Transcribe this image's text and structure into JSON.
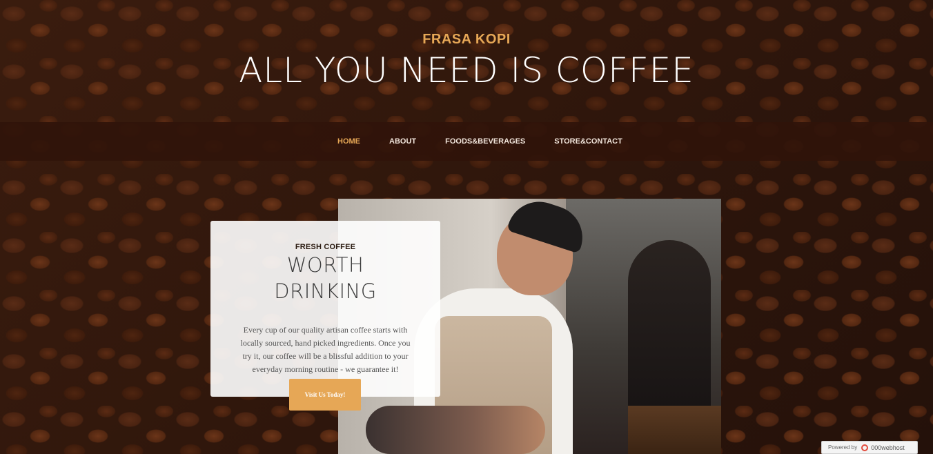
{
  "site": {
    "upper": "FRASA KOPI",
    "lower": "ALL YOU NEED IS COFFEE"
  },
  "nav": {
    "items": [
      {
        "label": "HOME",
        "active": true
      },
      {
        "label": "ABOUT",
        "active": false
      },
      {
        "label": "FOODS&BEVERAGES",
        "active": false
      },
      {
        "label": "STORE&CONTACT",
        "active": false
      }
    ]
  },
  "intro": {
    "upper": "FRESH COFFEE",
    "lower_line1": "WORTH",
    "lower_line2": "DRINKING",
    "text": "Every cup of our quality artisan coffee starts with locally sourced, hand picked ingredients. Once you try it, our coffee will be a blissful addition to your everyday morning routine - we guarantee it!",
    "button_label": "Visit Us Today!",
    "image_icon": "barista-photo"
  },
  "footer_badge": {
    "powered_by": "Powered by",
    "host_name": "000webhost",
    "logo_icon": "000webhost-logo-icon"
  },
  "colors": {
    "accent": "#e6a756",
    "nav_background": "#30140a",
    "background": "#2a140b"
  }
}
